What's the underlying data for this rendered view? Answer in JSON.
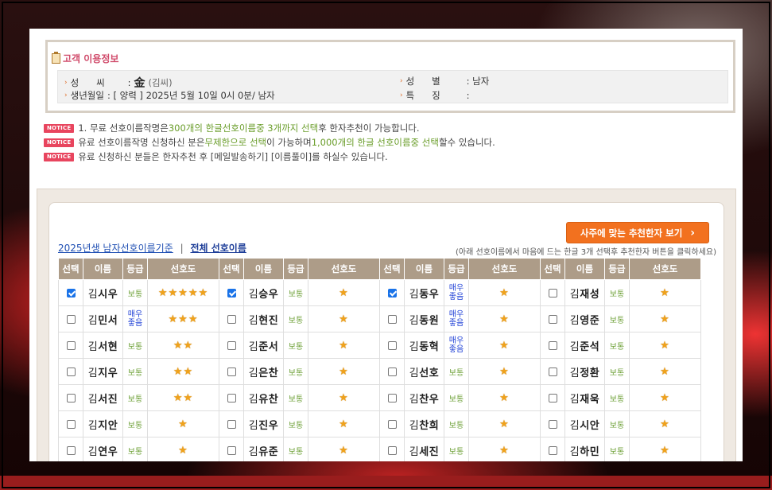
{
  "info": {
    "title": "고객 이용정보",
    "surname_label": "성      씨",
    "surname_hanja": "金",
    "surname_note": "(김씨)",
    "gender_label": "성      별",
    "gender_value": ": 남자",
    "birth_label": "생년월일",
    "birth_value": ": [ 양력 ] 2025년 5월 10일 0시 0분/ 남자",
    "trait_label": "특      징",
    "trait_value": ":"
  },
  "notices": {
    "badge": "NOTICE",
    "n1a": "1. 무료 선호이름작명은 ",
    "n1b": "300개의 한글선호이름중 3개까지 선택",
    "n1c": "후 한자추천이 가능합니다.",
    "n2a": "유료 선호이름작명 신청하신 분은",
    "n2b": "무제한으로 선택",
    "n2c": "이 가능하며 ",
    "n2d": "1,000개의 한글 선호이름중 선택",
    "n2e": "할수 있습니다.",
    "n3": "유료 신청하신 분들은 한자추천 후 [메일발송하기] [이름풀이]를 하실수 있습니다."
  },
  "panel": {
    "recommend_button": "사주에 맞는 추천한자 보기",
    "link_criteria": "2025년생 남자선호이름기준",
    "separator": "|",
    "link_all": "전체 선호이름",
    "help": "(아래 선호이름에서 마음에 드는 한글 3개 선택후 추천한자 버튼을 클릭하세요)"
  },
  "table": {
    "headers": [
      "선택",
      "이름",
      "등급",
      "선호도"
    ],
    "grade_normal": "보통",
    "grade_great_1": "매우",
    "grade_great_2": "좋음",
    "rows": [
      [
        {
          "checked": true,
          "surname": "김",
          "given": "시우",
          "grade": "normal",
          "stars": "★★★★★"
        },
        {
          "checked": true,
          "surname": "김",
          "given": "승우",
          "grade": "normal",
          "stars": "★"
        },
        {
          "checked": true,
          "surname": "김",
          "given": "동우",
          "grade": "great",
          "stars": "★"
        },
        {
          "checked": false,
          "surname": "김",
          "given": "재성",
          "grade": "normal",
          "stars": "★"
        }
      ],
      [
        {
          "checked": false,
          "surname": "김",
          "given": "민서",
          "grade": "great",
          "stars": "★★★"
        },
        {
          "checked": false,
          "surname": "김",
          "given": "현진",
          "grade": "normal",
          "stars": "★"
        },
        {
          "checked": false,
          "surname": "김",
          "given": "동원",
          "grade": "great",
          "stars": "★"
        },
        {
          "checked": false,
          "surname": "김",
          "given": "영준",
          "grade": "normal",
          "stars": "★"
        }
      ],
      [
        {
          "checked": false,
          "surname": "김",
          "given": "서현",
          "grade": "normal",
          "stars": "★★"
        },
        {
          "checked": false,
          "surname": "김",
          "given": "준서",
          "grade": "normal",
          "stars": "★"
        },
        {
          "checked": false,
          "surname": "김",
          "given": "동혁",
          "grade": "great",
          "stars": "★"
        },
        {
          "checked": false,
          "surname": "김",
          "given": "준석",
          "grade": "normal",
          "stars": "★"
        }
      ],
      [
        {
          "checked": false,
          "surname": "김",
          "given": "지우",
          "grade": "normal",
          "stars": "★★"
        },
        {
          "checked": false,
          "surname": "김",
          "given": "은찬",
          "grade": "normal",
          "stars": "★"
        },
        {
          "checked": false,
          "surname": "김",
          "given": "선호",
          "grade": "normal",
          "stars": "★"
        },
        {
          "checked": false,
          "surname": "김",
          "given": "정환",
          "grade": "normal",
          "stars": "★"
        }
      ],
      [
        {
          "checked": false,
          "surname": "김",
          "given": "서진",
          "grade": "normal",
          "stars": "★★"
        },
        {
          "checked": false,
          "surname": "김",
          "given": "유찬",
          "grade": "normal",
          "stars": "★"
        },
        {
          "checked": false,
          "surname": "김",
          "given": "찬우",
          "grade": "normal",
          "stars": "★"
        },
        {
          "checked": false,
          "surname": "김",
          "given": "재욱",
          "grade": "normal",
          "stars": "★"
        }
      ],
      [
        {
          "checked": false,
          "surname": "김",
          "given": "지안",
          "grade": "normal",
          "stars": "★"
        },
        {
          "checked": false,
          "surname": "김",
          "given": "진우",
          "grade": "normal",
          "stars": "★"
        },
        {
          "checked": false,
          "surname": "김",
          "given": "찬희",
          "grade": "normal",
          "stars": "★"
        },
        {
          "checked": false,
          "surname": "김",
          "given": "시안",
          "grade": "normal",
          "stars": "★"
        }
      ],
      [
        {
          "checked": false,
          "surname": "김",
          "given": "연우",
          "grade": "normal",
          "stars": "★"
        },
        {
          "checked": false,
          "surname": "김",
          "given": "유준",
          "grade": "normal",
          "stars": "★"
        },
        {
          "checked": false,
          "surname": "김",
          "given": "세진",
          "grade": "normal",
          "stars": "★"
        },
        {
          "checked": false,
          "surname": "김",
          "given": "하민",
          "grade": "normal",
          "stars": "★"
        }
      ]
    ]
  }
}
